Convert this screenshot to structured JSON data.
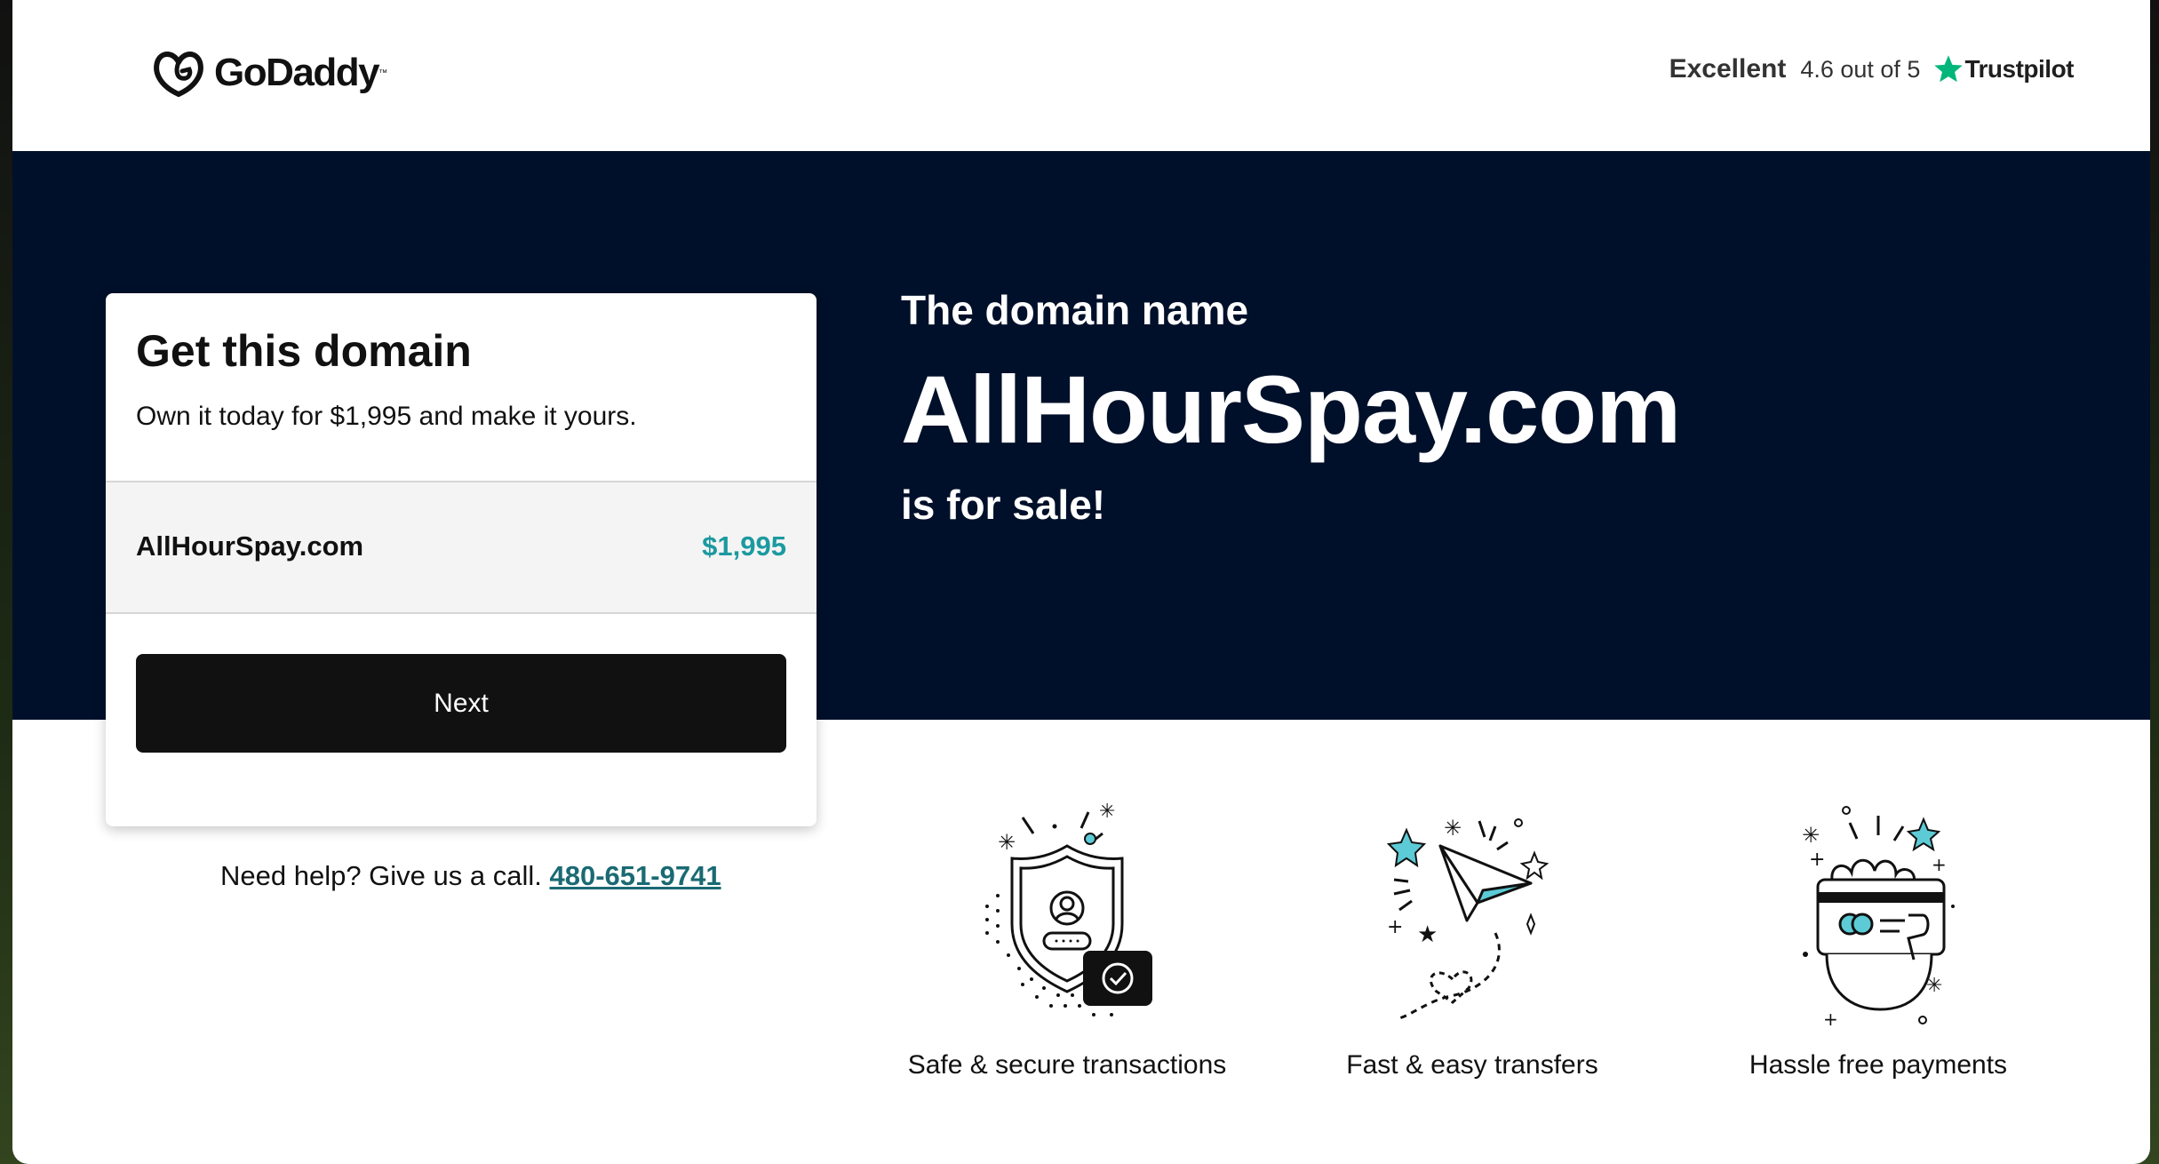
{
  "header": {
    "brand": "GoDaddy",
    "rating_label": "Excellent",
    "rating_score": "4.6 out of 5",
    "rating_source": "Trustpilot",
    "trustpilot_color": "#00b67a"
  },
  "hero": {
    "pre_text": "The domain name",
    "domain": "AllHourSpay.com",
    "post_text": "is for sale!",
    "background_color": "#01102a"
  },
  "card": {
    "title": "Get this domain",
    "subtitle": "Own it today for $1,995 and make it yours.",
    "row_domain": "AllHourSpay.com",
    "row_price": "$1,995",
    "price_color": "#1b9aa0",
    "next_label": "Next"
  },
  "help": {
    "text": "Need help? Give us a call.",
    "phone": "480-651-9741"
  },
  "features": [
    {
      "label": "Safe & secure transactions",
      "icon": "shield-icon"
    },
    {
      "label": "Fast & easy transfers",
      "icon": "paper-plane-icon"
    },
    {
      "label": "Hassle free payments",
      "icon": "card-payment-icon"
    }
  ]
}
